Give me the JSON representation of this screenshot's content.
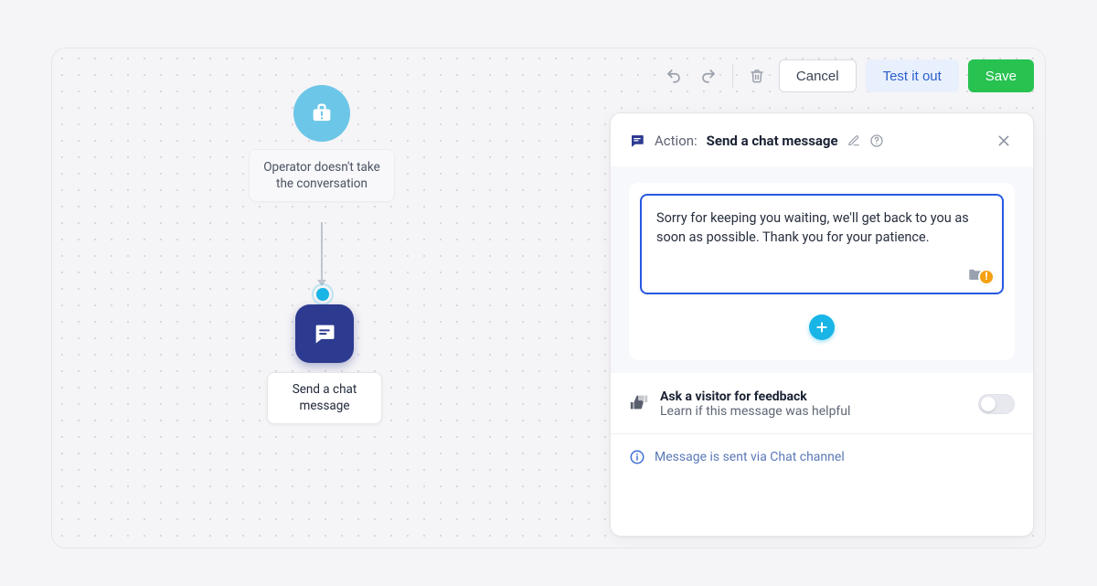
{
  "toolbar": {
    "cancel": "Cancel",
    "test": "Test it out",
    "save": "Save"
  },
  "flow": {
    "trigger_label": "Operator doesn't take the conversation",
    "action_label": "Send a chat message"
  },
  "panel": {
    "prefix": "Action:",
    "title": "Send a chat message",
    "message": "Sorry for keeping you waiting, we'll get back to you as soon as possible. Thank you for your patience.",
    "feedback_title": "Ask a visitor for feedback",
    "feedback_sub": "Learn if this message was helpful",
    "info": "Message is sent via Chat channel"
  }
}
